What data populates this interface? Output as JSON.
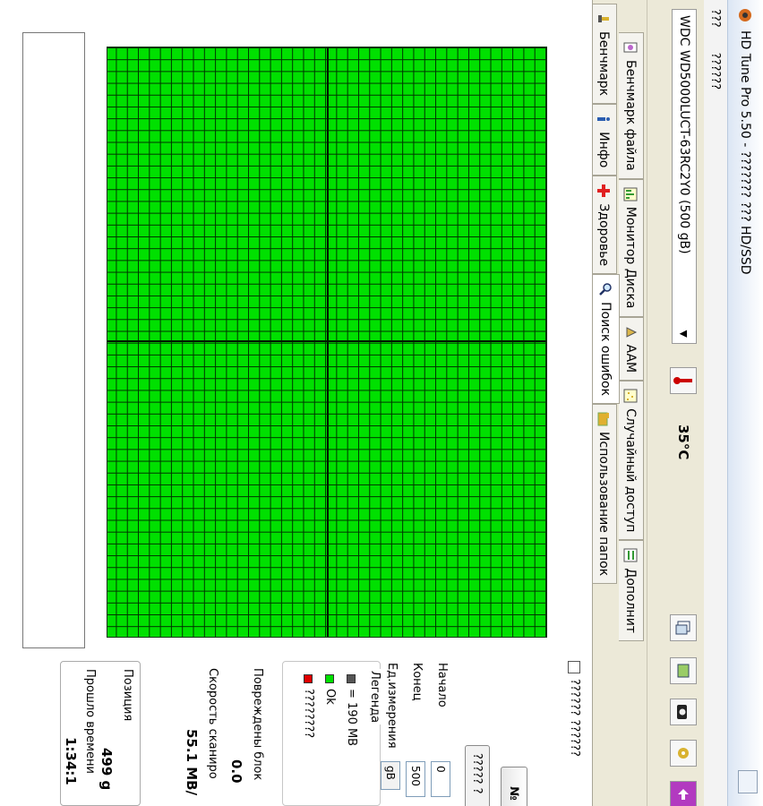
{
  "window": {
    "title": "HD Tune Pro 5.50 - ??????? ??? HD/SSD"
  },
  "menu": {
    "items": [
      "???",
      "??????"
    ]
  },
  "toolbar": {
    "drive": "WDC WD5000LUCT-63RC2Y0 (500 gB)",
    "temperature": "35°C"
  },
  "tabs": {
    "row1": [
      {
        "label": "Бенчмарк файла",
        "icon": "file-benchmark-icon"
      },
      {
        "label": "Монитор Диска",
        "icon": "disk-monitor-icon"
      },
      {
        "label": "AAM",
        "icon": "aam-icon"
      },
      {
        "label": "Случайный доступ",
        "icon": "random-access-icon"
      },
      {
        "label": "Дополнит",
        "icon": "extra-tests-icon"
      }
    ],
    "row2": [
      {
        "label": "Бенчмарк",
        "icon": "benchmark-icon"
      },
      {
        "label": "Инфо",
        "icon": "info-icon"
      },
      {
        "label": "Здоровье",
        "icon": "health-icon"
      },
      {
        "label": "Поиск ошибок",
        "icon": "error-scan-icon",
        "active": true
      },
      {
        "label": "Использование папок",
        "icon": "folder-usage-icon"
      }
    ]
  },
  "side": {
    "quick_scan_label": "?????? ??????",
    "start_label": "№",
    "options_label": "????? ?",
    "start_field": {
      "label": "Начало",
      "value": "0"
    },
    "end_field": {
      "label": "Конец",
      "value": "500"
    },
    "unit_field": {
      "label": "Ед.измерения",
      "value": "gB"
    }
  },
  "legend": {
    "title": "Легенда",
    "items": [
      {
        "label": "= 190 MB",
        "color": "#555555"
      },
      {
        "label": "Ok",
        "color": "#00e000"
      },
      {
        "label": "????????",
        "color": "#e00000"
      }
    ]
  },
  "stats": {
    "damaged_label": "Повреждены блок",
    "damaged_value": "0.0",
    "speed_label": "Скорость сканиро",
    "speed_value": "55.1 MB/",
    "position_label": "Позиция",
    "position_value": "499 g",
    "elapsed_label": "Прошло времени",
    "elapsed_value": "1:34:1"
  },
  "colors": {
    "ok_block": "#00e000",
    "grid_line": "#003300",
    "window_bg": "#ece9d8"
  }
}
